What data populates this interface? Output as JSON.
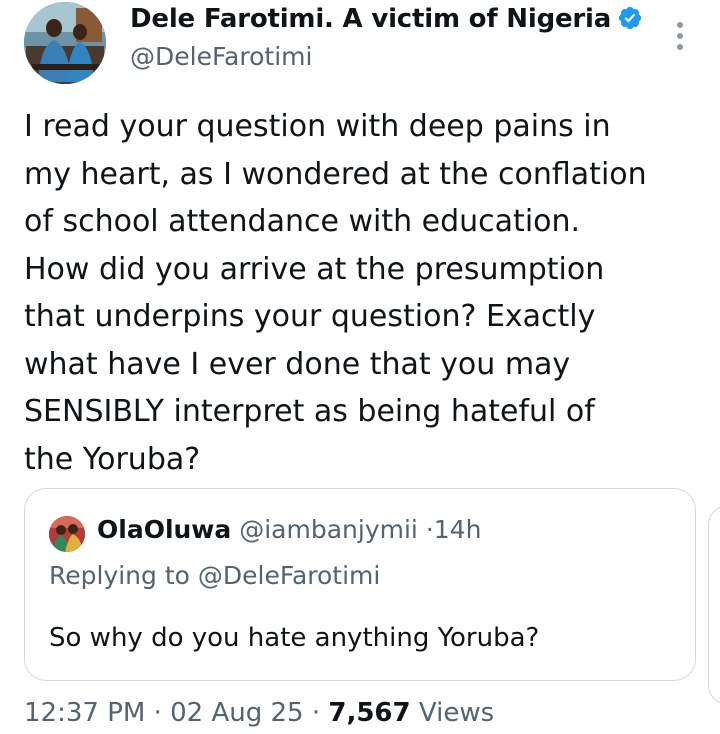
{
  "author": {
    "display_name": "Dele Farotimi. A victim of Nigeria",
    "handle": "@DeleFarotimi",
    "verified_icon": "verified-badge-icon",
    "accent_color": "#1d9bf0"
  },
  "tweet": {
    "lines": [
      "I read your question with deep pains in",
      "my heart, as I wondered at the conflation",
      "of school attendance with education.",
      "How did you arrive at the presumption",
      "that underpins your question? Exactly",
      "what have I ever done that you may",
      "SENSIBLY interpret as being hateful of",
      "the Yoruba?"
    ]
  },
  "quoted": {
    "name": "OlaOluwa",
    "handle": "@iambanjymii",
    "separator": "·",
    "time": "14h",
    "replying_prefix": "Replying to",
    "replying_to": "@DeleFarotimi",
    "text": "So why do you hate anything Yoruba?"
  },
  "meta": {
    "time": "12:37 PM",
    "date": "02 Aug 25",
    "separator": "·",
    "views_count": "7,567",
    "views_label": "Views"
  },
  "icons": {
    "more": "more-options-icon"
  }
}
